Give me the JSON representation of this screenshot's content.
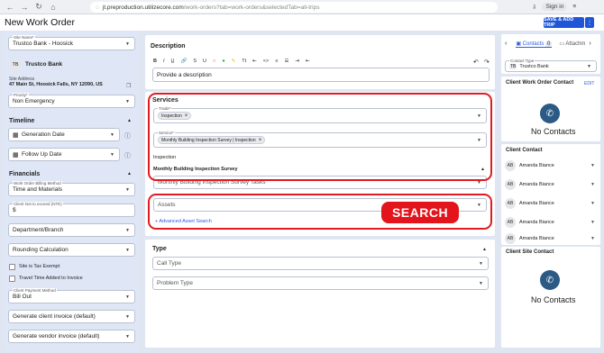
{
  "browser": {
    "nav_back": "←",
    "nav_forward": "→",
    "nav_reload": "↻",
    "nav_home": "⌂",
    "url_host": "jt.preproduction.utilizecore.com",
    "url_path": "/work-orders?tab=work-orders&selectedTab=all-trips",
    "sign_in": "Sign in"
  },
  "header": {
    "title": "New Work Order",
    "save_button": "SAVE & ADD TRIP",
    "more_button": "⋮"
  },
  "left": {
    "site_name_label": "Site Name*",
    "site_name_value": "Trustco Bank - Hoosick",
    "company_avatar": "TB",
    "company_name": "Trustco Bank",
    "site_address_label": "Site Address",
    "site_address_value": "47 Main St, Hoosick Falls, NY 12090, US",
    "priority_label": "Priority*",
    "priority_value": "Non Emergency",
    "timeline_title": "Timeline",
    "generation_date": "Generation Date",
    "follow_up_date": "Follow Up Date",
    "financials_title": "Financials",
    "billing_method_label": "Work Order Billing Method",
    "billing_method_value": "Time and Materials",
    "nte_label": "Client Not to exceed (NTE)",
    "nte_value": "$",
    "department": "Department/Branch",
    "rounding": "Rounding Calculation",
    "tax_exempt": "Site is Tax Exempt",
    "travel_time": "Travel Time Added to Invoice",
    "payment_method_label": "Client Payment Method",
    "payment_method_value": "Bill Out",
    "client_invoice": "Generate client invoice (default)",
    "vendor_invoice": "Generate vendor invoice (default)"
  },
  "middle": {
    "description_title": "Description",
    "toolbar": [
      "B",
      "I",
      "U̲",
      "🔗",
      "S",
      "U",
      "○",
      "●",
      "✎",
      "Tt",
      "⇤",
      "<>",
      "≡",
      "☰",
      "⇥",
      "⇤"
    ],
    "undo": "↶",
    "redo": "↷",
    "description_placeholder": "Provide a description",
    "services_title": "Services",
    "trade_label": "Trade*",
    "trade_chip": "Inspection",
    "service_label": "Service*",
    "service_chip": "Monthly Building Inspection Survey | Inspection",
    "inspection_title": "Inspection",
    "survey_title": "Monthly Building Inspection Survey",
    "survey_tasks": "Monthly Building Inspection Survey Tasks",
    "assets_placeholder": "Assets",
    "advanced_search": "+ Advanced Asset Search",
    "search_badge": "SEARCH",
    "type_title": "Type",
    "call_type": "Call Type",
    "problem_type": "Problem Type"
  },
  "right": {
    "tab_contacts": "Contacts",
    "contacts_count": "0",
    "tab_attachments": "Attachm",
    "contact_type_label": "Contact Type",
    "contact_type_avatar": "TB",
    "contact_type_value": "Trustco Bank",
    "client_wo_contact_title": "Client Work Order Contact",
    "edit_link": "EDIT",
    "no_contacts_1": "No Contacts",
    "client_contact_title": "Client Contact",
    "contacts": [
      {
        "initials": "AB",
        "name": "Amanda Biance"
      },
      {
        "initials": "AB",
        "name": "Amanda Biance"
      },
      {
        "initials": "AB",
        "name": "Amanda Biance"
      },
      {
        "initials": "AB",
        "name": "Amanda Biance"
      },
      {
        "initials": "AB",
        "name": "Amanda Biance"
      }
    ],
    "client_site_contact_title": "Client Site Contact",
    "no_contacts_2": "No Contacts"
  },
  "colors": {
    "accent": "#1f56d8",
    "highlight": "#e01b22",
    "phone": "#2b5a85"
  }
}
